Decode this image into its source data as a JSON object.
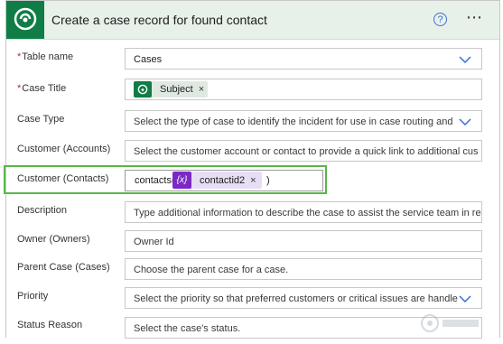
{
  "header": {
    "title": "Create a case record for found contact",
    "help_glyph": "?",
    "more_glyph": "⋯",
    "accent": "#0f7d45",
    "bg": "#e8f1e9"
  },
  "fields": [
    {
      "label": "Table name",
      "required": "*",
      "value": "Cases",
      "has_dropdown": true
    },
    {
      "label": "Case Title",
      "required": "*",
      "token": {
        "label": "Subject",
        "remove": "×",
        "icon": "dataverse-icon"
      }
    },
    {
      "label": "Case Type",
      "placeholder": "Select the type of case to identify the incident for use in case routing and",
      "has_dropdown": true
    },
    {
      "label": "Customer (Accounts)",
      "placeholder": "Select the customer account or contact to provide a quick link to additional cus"
    },
    {
      "label": "Customer (Contacts)",
      "expression": {
        "prefix": "contacts(",
        "variable": "contactid2",
        "var_icon": "{x}",
        "remove": "×",
        "suffix": ")"
      }
    },
    {
      "label": "Description",
      "placeholder": "Type additional information to describe the case to assist the service team in re"
    },
    {
      "label": "Owner (Owners)",
      "placeholder": "Owner Id"
    },
    {
      "label": "Parent Case (Cases)",
      "placeholder": "Choose the parent case for a case."
    },
    {
      "label": "Priority",
      "placeholder": "Select the priority so that preferred customers or critical issues are handle",
      "has_dropdown": true
    },
    {
      "label": "Status Reason",
      "placeholder": "Select the case's status."
    }
  ],
  "highlight_color": "#57b847"
}
